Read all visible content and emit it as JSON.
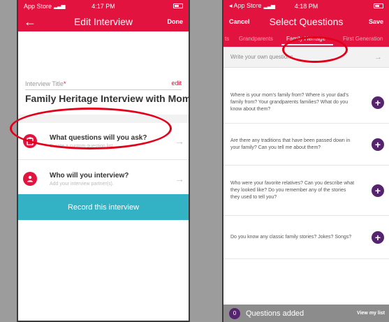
{
  "left_screen": {
    "status": {
      "carrier": "App Store",
      "time": "4:17 PM"
    },
    "nav": {
      "back_icon": "arrow-left-icon",
      "back_glyph": "←",
      "title": "Edit Interview",
      "done_label": "Done"
    },
    "title_field": {
      "label": "Interview Title",
      "required_mark": "*",
      "edit_label": "edit",
      "value": "Family Heritage Interview with Mom"
    },
    "questions_row": {
      "icon": "clipboard-icon",
      "title": "What questions will you ask?",
      "subtitle": "Create a custom question list.",
      "arrow": "→"
    },
    "interviewee_row": {
      "icon": "person-icon",
      "title": "Who will you interview?",
      "subtitle": "Add your interview partner(s).",
      "arrow": "→"
    },
    "record_button": "Record this interview"
  },
  "right_screen": {
    "status": {
      "carrier": "◂ App Store",
      "time": "4:18 PM"
    },
    "nav": {
      "cancel_label": "Cancel",
      "title": "Select Questions",
      "save_label": "Save"
    },
    "tabs": [
      {
        "label": "ts"
      },
      {
        "label": "Grandparents"
      },
      {
        "label": "Family Heritage",
        "active": true
      },
      {
        "label": "First Generation"
      }
    ],
    "write_own": {
      "placeholder": "Write your own questions",
      "arrow": "→"
    },
    "questions": [
      {
        "text": "Where is your mom's family from? Where is your dad's family from? Your grandparents families? What do you know about them?"
      },
      {
        "text": "Are there any traditions that have been passed down in your family? Can you tell me about them?"
      },
      {
        "text": "Who were your favorite relatives? Can you describe what they looked like? Do you remember any of the stories they used to tell you?"
      },
      {
        "text": "Do you know any classic family stories? Jokes? Songs?"
      }
    ],
    "add_glyph": "+",
    "bottom_bar": {
      "count": "0",
      "label": "Questions added",
      "view_list": "View my list"
    }
  },
  "colors": {
    "brand_red": "#e2143f",
    "record_teal": "#34b2c5",
    "purple": "#56246e",
    "annotation_red": "#e2001a"
  }
}
